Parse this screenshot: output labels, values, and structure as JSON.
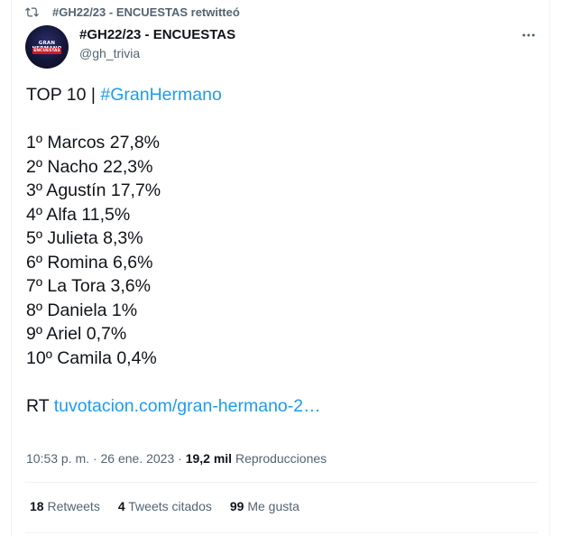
{
  "retweet_banner": {
    "icon": "retweet-icon",
    "text": "#GH22/23 - ENCUESTAS retwitteó"
  },
  "author": {
    "avatar_line1": "GRAN HERMANO",
    "avatar_line2": "ENCUESTAS",
    "name": "#GH22/23 - ENCUESTAS",
    "handle": "@gh_trivia"
  },
  "more_icon": "more-options-icon",
  "tweet": {
    "title_prefix": "TOP 10 | ",
    "title_hashtag": "#GranHermano",
    "rankings": [
      "1º Marcos 27,8%",
      "2º Nacho 22,3%",
      "3º Agustín 17,7%",
      "4º Alfa 11,5%",
      "5º Julieta 8,3%",
      "6º Romina 6,6%",
      "7º La Tora 3,6%",
      "8º Daniela 1%",
      "9º Ariel 0,7%",
      "10º Camila 0,4%"
    ],
    "rt_prefix": "RT ",
    "rt_link": "tuvotacion.com/gran-hermano-2…"
  },
  "meta": {
    "time": "10:53 p. m.",
    "separator1": " · ",
    "date": "26 ene. 2023",
    "separator2": " · ",
    "views_count": "19,2 mil",
    "views_label": " Reproducciones"
  },
  "stats": {
    "retweets_count": "18",
    "retweets_label": " Retweets",
    "quotes_count": "4",
    "quotes_label": " Tweets citados",
    "likes_count": "99",
    "likes_label": " Me gusta"
  },
  "colors": {
    "accent": "#1d9bf0",
    "text_primary": "#0f1419",
    "text_secondary": "#536471",
    "divider": "#eff3f4"
  }
}
